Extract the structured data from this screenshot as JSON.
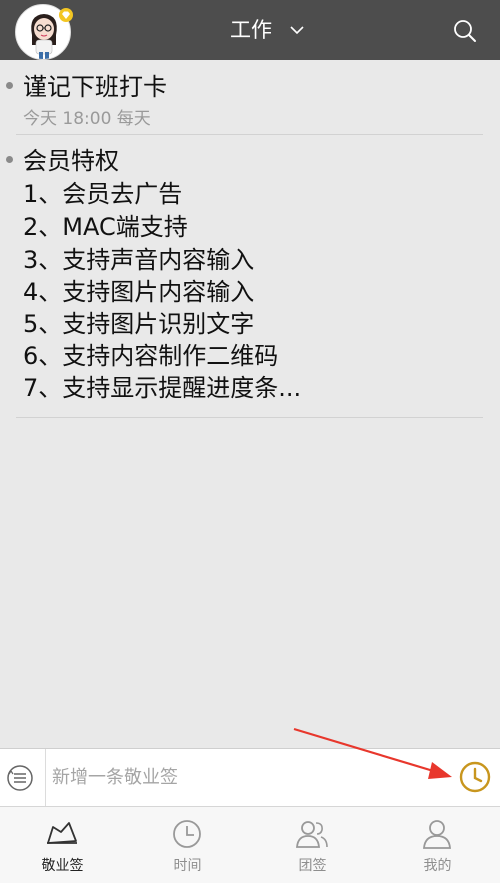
{
  "header": {
    "title": "工作"
  },
  "notes": [
    {
      "title": "谨记下班打卡",
      "meta": "今天 18:00   每天"
    },
    {
      "title": "会员特权",
      "lines": [
        "1、会员去广告",
        "2、MAC端支持",
        "3、支持声音内容输入",
        "4、支持图片内容输入",
        "5、支持图片识别文字",
        "6、支持内容制作二维码",
        "7、支持显示提醒进度条..."
      ]
    }
  ],
  "input": {
    "placeholder": "新增一条敬业签"
  },
  "tabs": [
    {
      "label": "敬业签",
      "icon": "note-icon",
      "active": true
    },
    {
      "label": "时间",
      "icon": "clock-icon",
      "active": false
    },
    {
      "label": "团签",
      "icon": "team-icon",
      "active": false
    },
    {
      "label": "我的",
      "icon": "user-icon",
      "active": false
    }
  ],
  "colors": {
    "header_bg": "#4d4d4d",
    "content_bg": "#e9e9e9",
    "clock_accent": "#c8961e",
    "annotation_arrow": "#e8372c"
  }
}
